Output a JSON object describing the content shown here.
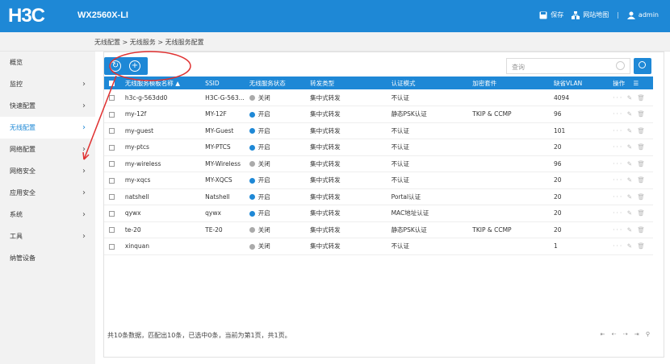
{
  "header": {
    "logo": "H3C",
    "model": "WX2560X-LI",
    "save_label": "保存",
    "sitemap_label": "网站地图",
    "separator": "|",
    "user": "admin"
  },
  "breadcrumb": "无线配置 > 无线服务 > 无线服务配置",
  "sidebar": {
    "items": [
      {
        "label": "概览",
        "chevron": ""
      },
      {
        "label": "监控",
        "chevron": "›"
      },
      {
        "label": "快速配置",
        "chevron": "›"
      },
      {
        "label": "无线配置",
        "chevron": "›"
      },
      {
        "label": "网络配置",
        "chevron": "›"
      },
      {
        "label": "网络安全",
        "chevron": "›"
      },
      {
        "label": "应用安全",
        "chevron": "›"
      },
      {
        "label": "系统",
        "chevron": "›"
      },
      {
        "label": "工具",
        "chevron": "›"
      },
      {
        "label": "纳管设备",
        "chevron": ""
      }
    ],
    "active_index": 3
  },
  "toolbar": {
    "refresh_icon": "↻",
    "add_icon": "+",
    "search_placeholder": "查询"
  },
  "table": {
    "columns": [
      "无线服务模板名称",
      "SSID",
      "无线服务状态",
      "转发类型",
      "认证模式",
      "加密套件",
      "缺省VLAN",
      "操作"
    ],
    "rows": [
      {
        "name": "h3c-g-563dd0",
        "ssid": "H3C-G-563...",
        "status": "关闭",
        "forward": "集中式转发",
        "auth": "不认证",
        "cipher": "",
        "vlan": "4094"
      },
      {
        "name": "my-12f",
        "ssid": "MY-12F",
        "status": "开启",
        "forward": "集中式转发",
        "auth": "静态PSK认证",
        "cipher": "TKIP & CCMP",
        "vlan": "96"
      },
      {
        "name": "my-guest",
        "ssid": "MY-Guest",
        "status": "开启",
        "forward": "集中式转发",
        "auth": "不认证",
        "cipher": "",
        "vlan": "101"
      },
      {
        "name": "my-ptcs",
        "ssid": "MY-PTCS",
        "status": "开启",
        "forward": "集中式转发",
        "auth": "不认证",
        "cipher": "",
        "vlan": "20"
      },
      {
        "name": "my-wireless",
        "ssid": "MY-Wireless",
        "status": "关闭",
        "forward": "集中式转发",
        "auth": "不认证",
        "cipher": "",
        "vlan": "96"
      },
      {
        "name": "my-xqcs",
        "ssid": "MY-XQCS",
        "status": "开启",
        "forward": "集中式转发",
        "auth": "不认证",
        "cipher": "",
        "vlan": "20"
      },
      {
        "name": "natshell",
        "ssid": "Natshell",
        "status": "开启",
        "forward": "集中式转发",
        "auth": "Portal认证",
        "cipher": "",
        "vlan": "20"
      },
      {
        "name": "qywx",
        "ssid": "qywx",
        "status": "开启",
        "forward": "集中式转发",
        "auth": "MAC地址认证",
        "cipher": "",
        "vlan": "20"
      },
      {
        "name": "te-20",
        "ssid": "TE-20",
        "status": "关闭",
        "forward": "集中式转发",
        "auth": "静态PSK认证",
        "cipher": "TKIP & CCMP",
        "vlan": "20"
      },
      {
        "name": "xinquan",
        "ssid": "",
        "status": "关闭",
        "forward": "集中式转发",
        "auth": "不认证",
        "cipher": "",
        "vlan": "1"
      }
    ],
    "ops_icons": "··· ✎ 🗑",
    "sort_icon": "▲",
    "menu_icon": "☰"
  },
  "footer": {
    "summary": "共10条数据，匹配出10条，已选中0条，当前为第1页，共1页。",
    "pager": "⇤ ⇠ ⇢ ⇥ ⚲"
  },
  "colors": {
    "brand": "#1e88d6",
    "status_on": "#1e88d6",
    "status_off": "#aaaaaa",
    "annotation": "#e03030"
  }
}
